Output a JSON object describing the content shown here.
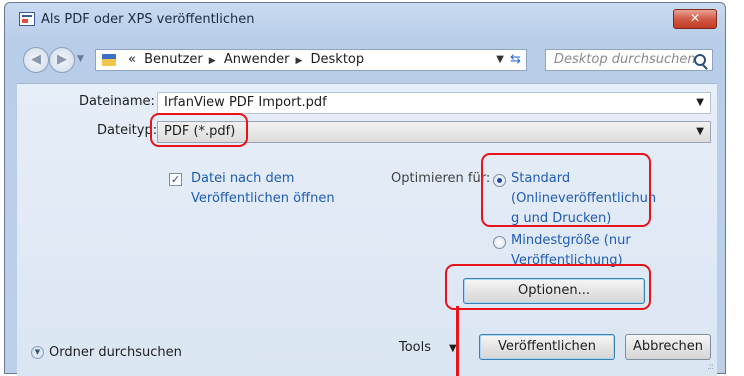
{
  "window": {
    "title": "Als PDF oder XPS veröffentlichen",
    "close_label": "✕"
  },
  "nav": {
    "breadcrumb": [
      "«",
      "Benutzer",
      "Anwender",
      "Desktop"
    ],
    "search_placeholder": "Desktop durchsuchen"
  },
  "form": {
    "filename_label": "Dateiname:",
    "filename_value": "IrfanView PDF Import.pdf",
    "filetype_label": "Dateityp:",
    "filetype_value": "PDF (*.pdf)"
  },
  "options": {
    "open_after_line1": "Datei nach dem",
    "open_after_line2": "Veröffentlichen öffnen",
    "open_after_checked": true,
    "optimize_label": "Optimieren für:",
    "standard_lines": [
      "Standard",
      "(Onlineveröffentlichun",
      "g und Drucken)"
    ],
    "minimum_lines": [
      "Mindestgröße (nur",
      "Veröffentlichung)"
    ],
    "selected": "standard"
  },
  "buttons": {
    "options": "Optionen...",
    "tools": "Tools",
    "publish": "Veröffentlichen",
    "cancel": "Abbrechen"
  },
  "footer": {
    "browse_folders": "Ordner durchsuchen"
  },
  "colors": {
    "highlight": "#e8131b",
    "link": "#1f5bb8"
  }
}
